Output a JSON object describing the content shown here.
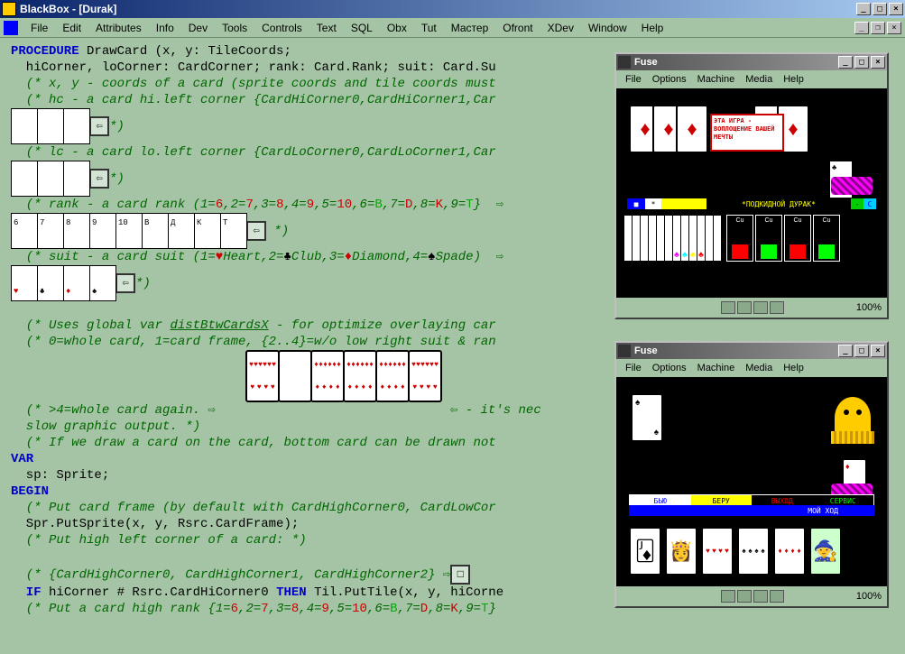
{
  "main": {
    "title": "BlackBox - [Durak]",
    "menu": [
      "File",
      "Edit",
      "Attributes",
      "Info",
      "Dev",
      "Tools",
      "Controls",
      "Text",
      "SQL",
      "Obx",
      "Tut",
      "Мастер",
      "Ofront",
      "XDev",
      "Window",
      "Help"
    ]
  },
  "code": {
    "l01a": "PROCEDURE",
    "l01b": " DrawCard (x, y: TileCoords;",
    "l02": "  hiCorner, loCorner: CardCorner; rank: Card.Rank; suit: Card.Su",
    "l03": "  (* x, y - coords of a card (sprite coords and tile coords must",
    "l04": "  (* hc - a card hi.left corner {CardHiCorner0,CardHiCorner1,Car",
    "l04arrow": "⇦*)",
    "l05": "  (* lc - a card lo.left corner {CardLoCorner0,CardLoCorner1,Car",
    "l05arrow": "⇦*)",
    "l06a": "  (* rank - a card rank (1=",
    "l06arrow": "⇨ *)",
    "l07a": "  (* suit - a card suit (1=",
    "l07heart": "Heart",
    "l07club": "Club",
    "l07diamond": "Diamond",
    "l07spade": "Spade",
    "l07end": ")  ⇨",
    "l07arrow2": "⇦*)",
    "l08a": "  (* Uses global var ",
    "l08u": "distBtwCardsX",
    "l08b": " - for optimize overlaying car",
    "l09": "  (* 0=whole card, 1=card frame, {2..4}=w/o low right suit & ran",
    "l10a": "  (* >4=whole card again. ⇨",
    "l10b": "⇦ - it's nec",
    "l11": "  slow graphic output. *)",
    "l12": "  (* If we draw a card on the card, bottom card can be drawn not",
    "l13": "VAR",
    "l14": "  sp: Sprite;",
    "l15": "BEGIN",
    "l16": "  (* Put card frame (by default with CardHighCorner0, CardLowCor",
    "l17": "  Spr.PutSprite(x, y, Rsrc.CardFrame);",
    "l18": "  (* Put high left corner of a card: *)",
    "l19a": "  (* {CardHighCorner0, CardHighCorner1, CardHighCorner2} ",
    "l19b": "⇨",
    "l20a": "  IF",
    "l20b": " hiCorner # Rsrc.CardHiCorner0 ",
    "l20c": "THEN",
    "l20d": " Til.PutTile(x, y, hiCorne",
    "l21a": "  (* Put a card high rank {1=",
    "ranks": [
      "6",
      "7",
      "8",
      "9",
      "10"
    ],
    "letters": {
      "b": "B",
      "d": "D",
      "k": "K",
      "t": "T"
    }
  },
  "fuse1": {
    "title": "Fuse",
    "menu": [
      "File",
      "Options",
      "Machine",
      "Media",
      "Help"
    ],
    "banner": "ЭТА ИГРА - ВОПЛОЩЕНИЕ ВАШЕЙ МЕЧТЫ",
    "status_label": "*ПОДКИДНОЙ ДУРАК* ",
    "zoom": "100%"
  },
  "fuse2": {
    "title": "Fuse",
    "menu": [
      "File",
      "Options",
      "Machine",
      "Media",
      "Help"
    ],
    "menu_bar": {
      "b1": "БЬЮ",
      "b2": "БЕРУ",
      "b3": "ВЫХОД",
      "b4": "СЕРВИС"
    },
    "turn": "МОЙ  ХОД",
    "zoom": "100%"
  }
}
